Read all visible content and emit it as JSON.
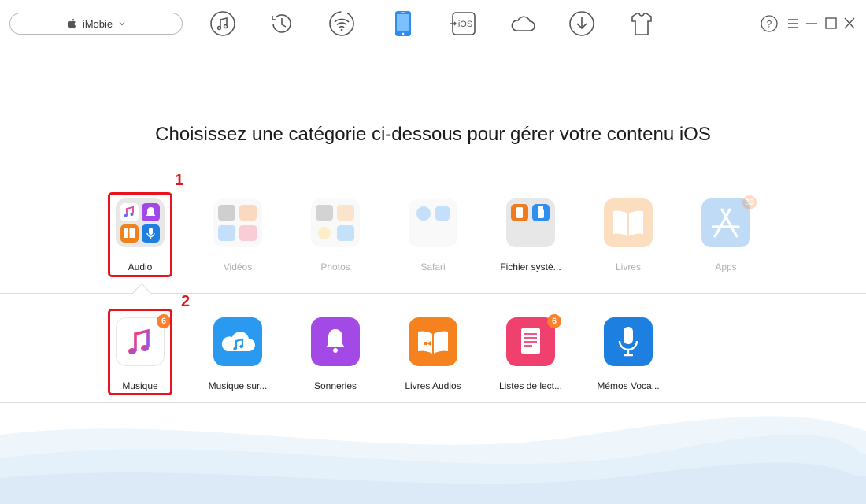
{
  "topbar": {
    "device_name": "iMobie",
    "nav_icons": [
      "music-icon",
      "history-icon",
      "wifi-icon",
      "phone-icon",
      "ios-icon",
      "cloud-icon",
      "download-icon",
      "tshirt-icon"
    ],
    "ios_label": "iOS",
    "help_label": "?"
  },
  "main": {
    "headline": "Choisissez une catégorie ci-dessous pour gérer votre contenu iOS"
  },
  "categories": [
    {
      "label": "Audio"
    },
    {
      "label": "Vidéos"
    },
    {
      "label": "Photos"
    },
    {
      "label": "Safari"
    },
    {
      "label": "Fichier systè..."
    },
    {
      "label": "Livres"
    },
    {
      "label": "Apps",
      "badge": "33"
    }
  ],
  "subcategories": [
    {
      "label": "Musique",
      "badge": "6"
    },
    {
      "label": "Musique sur..."
    },
    {
      "label": "Sonneries"
    },
    {
      "label": "Livres Audios"
    },
    {
      "label": "Listes de lect...",
      "badge": "6"
    },
    {
      "label": "Mémos Voca..."
    }
  ],
  "annotations": {
    "step1": "1",
    "step2": "2"
  },
  "colors": {
    "accent_blue": "#1e90ff",
    "annotation_red": "#e8131e",
    "badge_orange": "#ff7f2a"
  }
}
